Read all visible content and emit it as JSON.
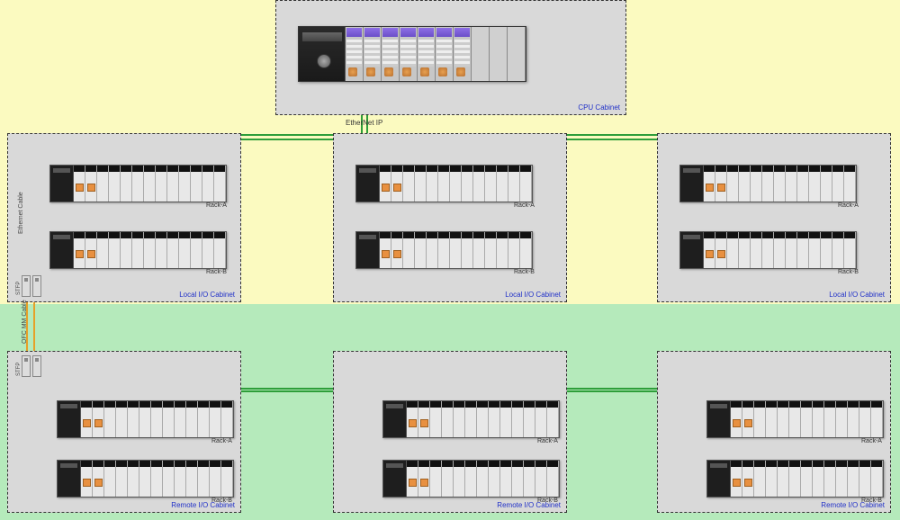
{
  "network_label": "EtherNet IP",
  "cpu_cabinet": {
    "label": "CPU Cabinet",
    "slot_count": 10,
    "filled_slots": 7,
    "empty_tabs": [
      "",
      "",
      ""
    ]
  },
  "local_cabinets": {
    "label": "Local I/O Cabinet",
    "rack_a_label": "Rack-A",
    "rack_b_label": "Rack-B",
    "count": 3,
    "slots_per_rack": 13
  },
  "remote_cabinets": {
    "label": "Remote I/O Cabinet",
    "rack_a_label": "Rack-A",
    "rack_b_label": "Rack-B",
    "count": 3,
    "slots_per_rack": 13
  },
  "side_labels": {
    "ethernet_cable": "Ethernet Cable",
    "ofc_mm_cable": "OFC MM Cable",
    "stfp_upper": "STFP",
    "stfp_lower": "STFP"
  },
  "colors": {
    "bg_upper": "#fbfac0",
    "bg_lower": "#b5eabb",
    "cabinet_fill": "#d9d9d9",
    "wire_green": "#2e9e3a",
    "wire_orange": "#e6a028",
    "wire_blue": "#3040d0",
    "label_blue": "#2030c8"
  }
}
